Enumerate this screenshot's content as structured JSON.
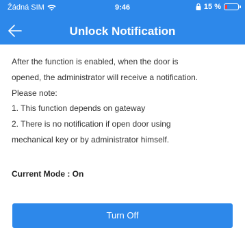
{
  "status_bar": {
    "carrier": "Žádná SIM",
    "time": "9:46",
    "battery_percent": "15 %",
    "battery_level": 0.15,
    "battery_color": "#ff3b30"
  },
  "nav": {
    "title": "Unlock Notification",
    "back_icon": "arrow-left-icon"
  },
  "description": {
    "lines": [
      "After the function is enabled, when the door is",
      "opened, the administrator will receive a notification.",
      "Please note:",
      "1. This function depends on gateway",
      "2. There is no notification if open door using",
      "mechanical key or by administrator himself."
    ]
  },
  "mode": {
    "text": "Current Mode : On"
  },
  "action": {
    "label": "Turn Off"
  },
  "colors": {
    "accent": "#2d88ea",
    "text": "#333333"
  }
}
